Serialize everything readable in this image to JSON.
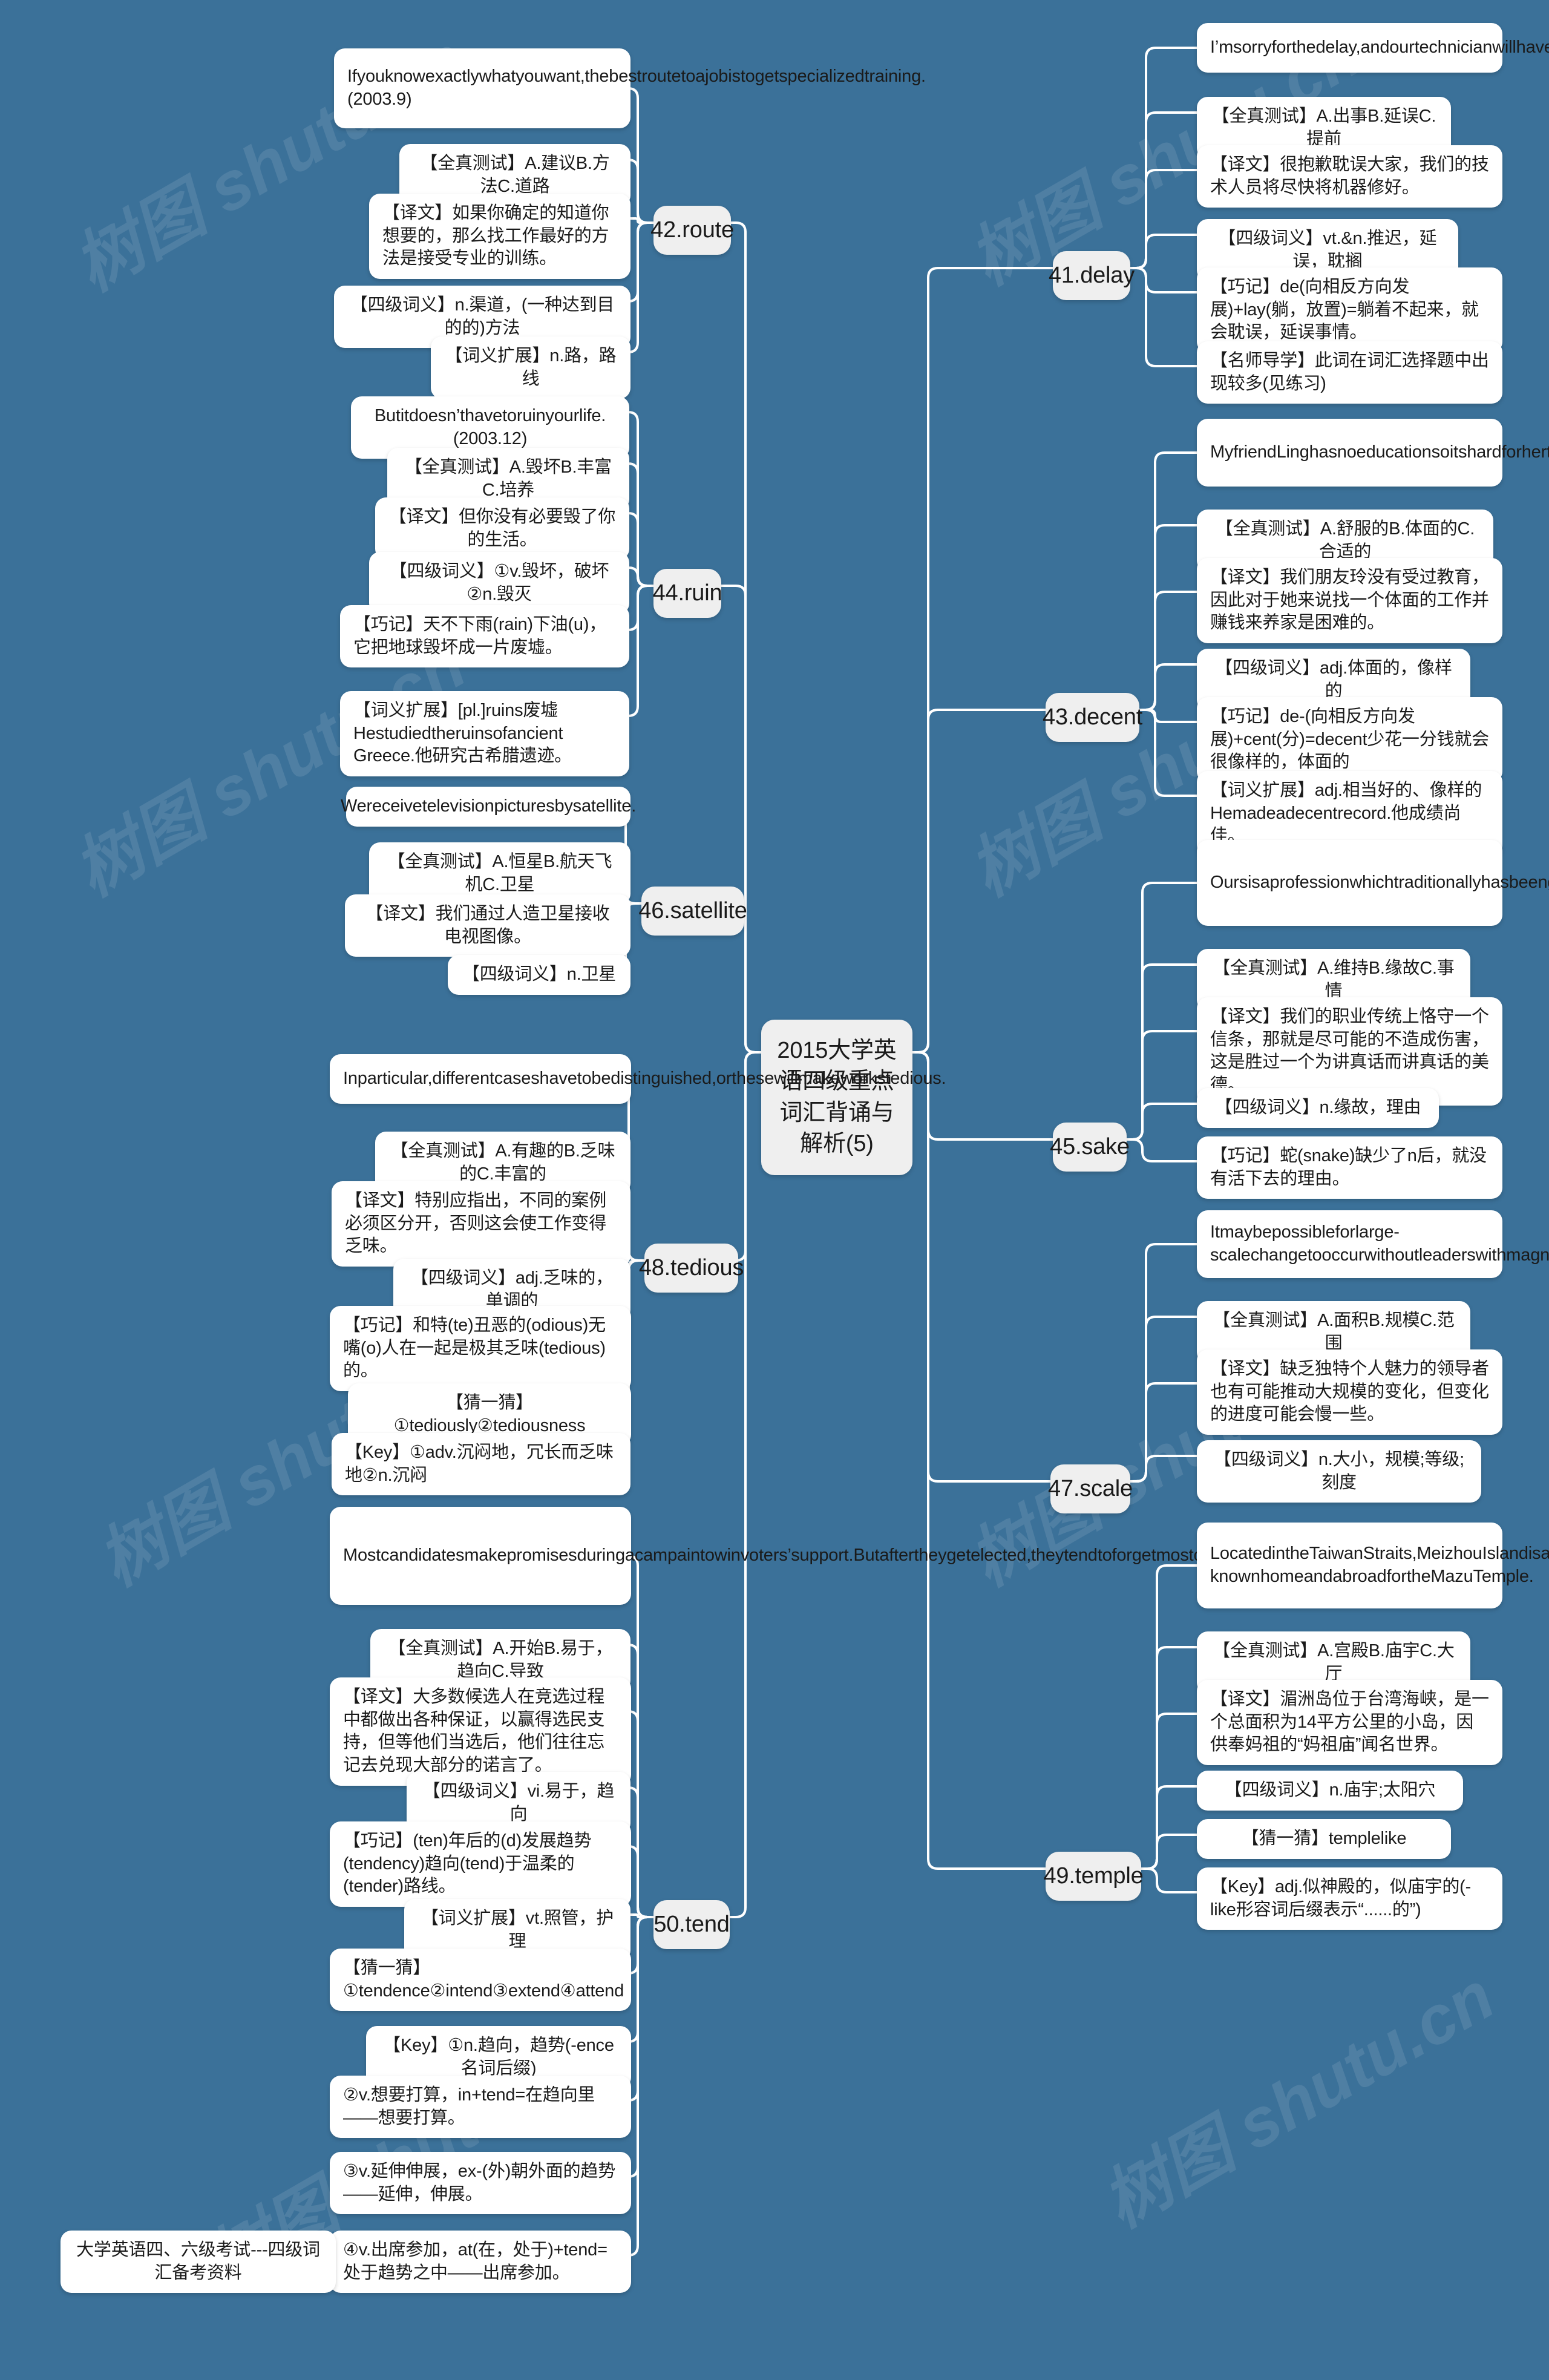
{
  "meta": {
    "background_color": "#3b7199",
    "node_color": "#ffffff",
    "topic_color": "#efefef",
    "link_color": "#ffffff",
    "watermark_text_1": "树图 shutu.cn",
    "watermark_text_2": "树图shutu.cn"
  },
  "center": {
    "title": "2015大学英语四级重点词汇背诵与解析(5)"
  },
  "footer": {
    "label": "大学英语四、六级考试---四级词汇备考资料"
  },
  "left_topics": [
    {
      "id": "route",
      "label": "42.route",
      "children": [
        "Ifyouknowexactlywhatyouwant,thebestroutetoajobistogetspecializedtraining.(2003.9)",
        "【全真测试】A.建议B.方法C.道路",
        "【译文】如果你确定的知道你想要的，那么找工作最好的方法是接受专业的训练。",
        "【四级词义】n.渠道，(一种达到目的的)方法",
        "【词义扩展】n.路，路线"
      ]
    },
    {
      "id": "ruin",
      "label": "44.ruin",
      "children": [
        "Butitdoesn’thavetoruinyourlife.(2003.12)",
        "【全真测试】A.毁坏B.丰富C.培养",
        "【译文】但你没有必要毁了你的生活。",
        "【四级词义】①v.毁坏，破坏②n.毁灭",
        "【巧记】天不下雨(rain)下油(u)，它把地球毁坏成一片废墟。",
        "【词义扩展】[pl.]ruins废墟Hestudiedtheruinsofancient Greece.他研究古希腊遗迹。"
      ]
    },
    {
      "id": "satellite",
      "label": "46.satellite",
      "children": [
        "Wereceivetelevisionpicturesbysatellite.",
        "【全真测试】A.恒星B.航天飞机C.卫星",
        "【译文】我们通过人造卫星接收电视图像。",
        "【四级词义】n.卫星"
      ]
    },
    {
      "id": "tedious",
      "label": "48.tedious",
      "children": [
        "Inparticular,differentcaseshavetobedistinguished,orthesewillmakeworkstedious.",
        "【全真测试】A.有趣的B.乏味的C.丰富的",
        "【译文】特别应指出，不同的案例必须区分开，否则这会使工作变得乏味。",
        "【四级词义】adj.乏味的，单调的",
        "【巧记】和特(te)丑恶的(odious)无嘴(o)人在一起是极其乏味(tedious)的。",
        "【猜一猜】①tediously②tediousness",
        "【Key】①adv.沉闷地，冗长而乏味地②n.沉闷"
      ]
    },
    {
      "id": "tend",
      "label": "50.tend",
      "children": [
        "Mostcandidatesmakepromisesduringacampaintowinvoters’support.Butaftertheygetelected,theytendtoforgetmostofthingstheypromisetoachieve.",
        "【全真测试】A.开始B.易于，趋向C.导致",
        "【译文】大多数候选人在竞选过程中都做出各种保证，以赢得选民支持，但等他们当选后，他们往往忘记去兑现大部分的诺言了。",
        "【四级词义】vi.易于，趋向",
        "【巧记】(ten)年后的(d)发展趋势(tendency)趋向(tend)于温柔的(tender)路线。",
        "【词义扩展】vt.照管，护理",
        "【猜一猜】①tendence②intend③extend④attend",
        "【Key】①n.趋向，趋势(-ence名词后缀)",
        "②v.想要打算，in+tend=在趋向里——想要打算。",
        "③v.延伸伸展，ex-(外)朝外面的趋势——延伸，伸展。",
        "④v.出席参加，at(在，处于)+tend=处于趋势之中——出席参加。"
      ]
    }
  ],
  "right_topics": [
    {
      "id": "delay",
      "label": "41.delay",
      "children": [
        "I’msorryforthedelay,andourtechnicianwillhavethemichinefixedasquicklyaspossible.",
        "【全真测试】A.出事B.延误C.提前",
        "【译文】很抱歉耽误大家，我们的技术人员将尽快将机器修好。",
        "【四级词义】vt.&n.推迟，延误，耽搁",
        "【巧记】de(向相反方向发展)+lay(躺，放置)=躺着不起来，就会耽误，延误事情。",
        "【名师导学】此词在词汇选择题中出现较多(见练习)"
      ]
    },
    {
      "id": "decent",
      "label": "43.decent",
      "children": [
        "MyfriendLinghasnoeducationsoitshardforhertofindadecentjobandearnenoughmoneyforherfamily.",
        "【全真测试】A.舒服的B.体面的C.合适的",
        "【译文】我们朋友玲没有受过教育，因此对于她来说找一个体面的工作并赚钱来养家是困难的。",
        "【四级词义】adj.体面的，像样的",
        "【巧记】de-(向相反方向发展)+cent(分)=decent少花一分钱就会很像样的，体面的",
        "【词义扩展】adj.相当好的、像样的Hemadeadecentrecord.他成绩尚佳。"
      ]
    },
    {
      "id": "sake",
      "label": "45.sake",
      "children": [
        "Oursisaprofessionwhichtraditionallyhasbeenguidedbyaprecepttthattranscendsthevirtueofutteringthetruthfortruth’ssake,andthatisasfaraspossibledonoharm.",
        "【全真测试】A.维持B.缘故C.事情",
        "【译文】我们的职业传统上恪守一个信条，那就是尽可能的不造成伤害，这是胜过一个为讲真话而讲真话的美德。",
        "【四级词义】n.缘故，理由",
        "【巧记】蛇(snake)缺少了n后，就没有活下去的理由。"
      ]
    },
    {
      "id": "scale",
      "label": "47.scale",
      "children": [
        "Itmaybepossibleforlarge-scalechangetooccurwithoutleaderswithmagneticpersonalities,butthepaceofchangewouldbeslow.",
        "【全真测试】A.面积B.规模C.范围",
        "【译文】缺乏独特个人魅力的领导者也有可能推动大规模的变化，但变化的进度可能会慢一些。",
        "【四级词义】n.大小，规模;等级;刻度"
      ]
    },
    {
      "id": "temple",
      "label": "49.temple",
      "children": [
        "LocatedintheTaiwanStraits,MeizhouIslandisasmallislandwithatotalareaof14squarekilometers.Itiswell-knownhomeandabroadfortheMazuTemple.",
        "【全真测试】A.宫殿B.庙宇C.大厅",
        "【译文】湄洲岛位于台湾海峡，是一个总面积为14平方公里的小岛，因供奉妈祖的“妈祖庙”闻名世界。",
        "【四级词义】n.庙宇;太阳穴",
        "【猜一猜】templelike",
        "【Key】adj.似神殿的，似庙宇的(-like形容词后缀表示“......的”)"
      ]
    }
  ]
}
